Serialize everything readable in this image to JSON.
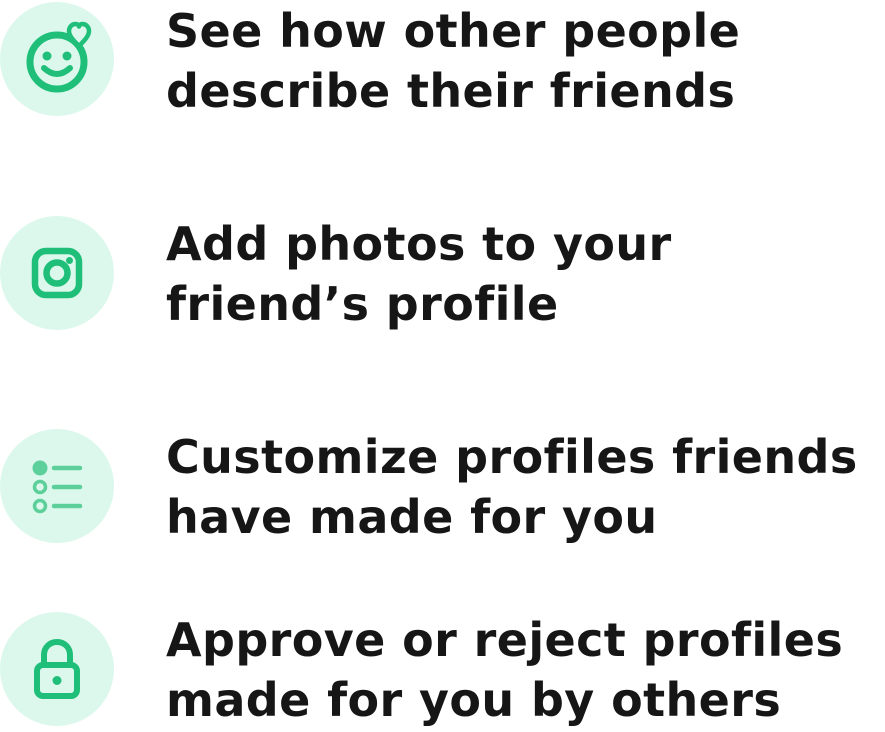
{
  "accent_color": "#1fbf7a",
  "icon_bg_color": "#dcf8ec",
  "features": [
    {
      "icon": "smiley-heart-icon",
      "lines": [
        "See how other people",
        "describe their friends"
      ]
    },
    {
      "icon": "camera-icon",
      "lines": [
        "Add photos to your",
        "friend’s profile"
      ]
    },
    {
      "icon": "list-icon",
      "lines": [
        "Customize profiles friends",
        "have made for you"
      ]
    },
    {
      "icon": "lock-icon",
      "lines": [
        "Approve or reject profiles",
        "made for you by others"
      ]
    }
  ]
}
